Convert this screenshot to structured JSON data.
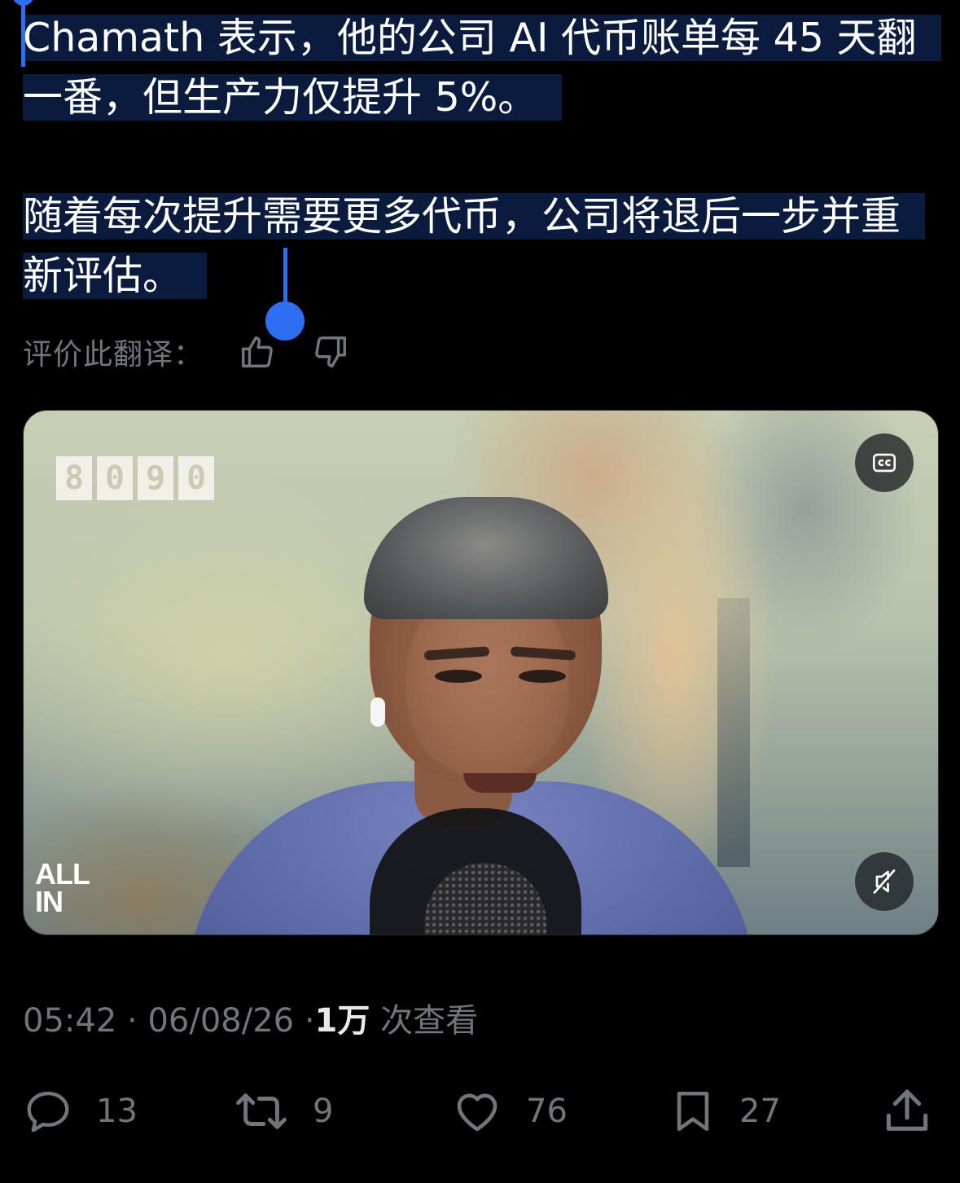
{
  "tweet": {
    "translation_line1": "Chamath 表示，他的公司 AI 代币账单每 45 天翻一番，但生产力仅提升 5%。",
    "translation_line2": "随着每次提升需要更多代币，公司将退后一步并重新评估。"
  },
  "rate_translation": {
    "label": "评价此翻译："
  },
  "video": {
    "watermark": "8090",
    "brand_line1": "ALL",
    "brand_line2": "IN",
    "cc_icon": "closed-captions-icon",
    "mute_icon": "muted-speaker-icon"
  },
  "meta": {
    "time": "05:42",
    "separator": "·",
    "date": "06/08/26",
    "views_count": "1万",
    "views_label": "次查看"
  },
  "actions": {
    "reply_count": "13",
    "retweet_count": "9",
    "like_count": "76",
    "bookmark_count": "27"
  },
  "colors": {
    "background": "#000000",
    "selection": "#0a1b3d",
    "selection_handle": "#2d6ff0",
    "secondary_text": "#71767b"
  }
}
